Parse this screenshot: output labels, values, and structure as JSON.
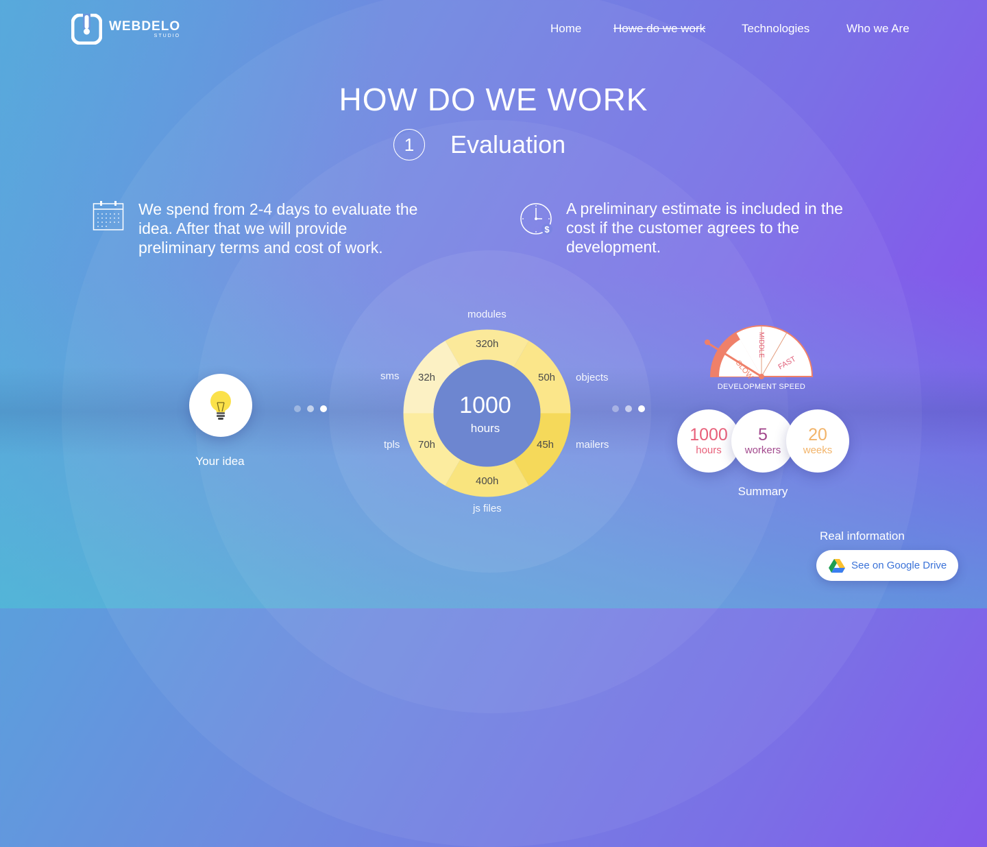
{
  "brand": {
    "name": "WEBDELO",
    "sub": "STUDIO"
  },
  "nav": [
    {
      "label": "Home",
      "active": false
    },
    {
      "label": "Howe do we work",
      "active": true
    },
    {
      "label": "Technologies",
      "active": false
    },
    {
      "label": "Who we Are",
      "active": false
    }
  ],
  "page_title": "HOW DO WE WORK",
  "step": {
    "number": "1",
    "title": "Evaluation"
  },
  "info": [
    {
      "icon": "calendar-icon",
      "text": "We spend from 2-4 days to evaluate the idea. After that we will provide preliminary terms and cost of work."
    },
    {
      "icon": "clock-dollar-icon",
      "text": "A preliminary estimate is included in the cost if the customer agrees to the development."
    }
  ],
  "idea": {
    "icon": "lightbulb-icon",
    "label": "Your idea"
  },
  "estimate": {
    "total": "1000",
    "unit": "hours",
    "segments": [
      {
        "name": "modules",
        "hours": "320h",
        "color": "#fbe99a"
      },
      {
        "name": "objects",
        "hours": "50h",
        "color": "#fbe68a"
      },
      {
        "name": "mailers",
        "hours": "45h",
        "color": "#f5d95a"
      },
      {
        "name": "js files",
        "hours": "400h",
        "color": "#f9e47e"
      },
      {
        "name": "tpls",
        "hours": "70h",
        "color": "#fcec9f"
      },
      {
        "name": "sms",
        "hours": "32h",
        "color": "#fcf1c4"
      }
    ]
  },
  "speed": {
    "label": "DEVELOPMENT SPEED",
    "options": [
      "SLOW",
      "MIDDLE",
      "FAST"
    ],
    "selected": "SLOW"
  },
  "summary": {
    "label": "Summary",
    "items": [
      {
        "value": "1000",
        "unit": "hours",
        "color": "#e8607a"
      },
      {
        "value": "5",
        "unit": "workers",
        "color": "#a34a8e"
      },
      {
        "value": "20",
        "unit": "weeks",
        "color": "#f2b46a"
      }
    ]
  },
  "real_info": {
    "title": "Real information",
    "button": "See on Google Drive"
  },
  "colors": {
    "accent": "#3a72d8",
    "gauge": "#ef8069"
  }
}
